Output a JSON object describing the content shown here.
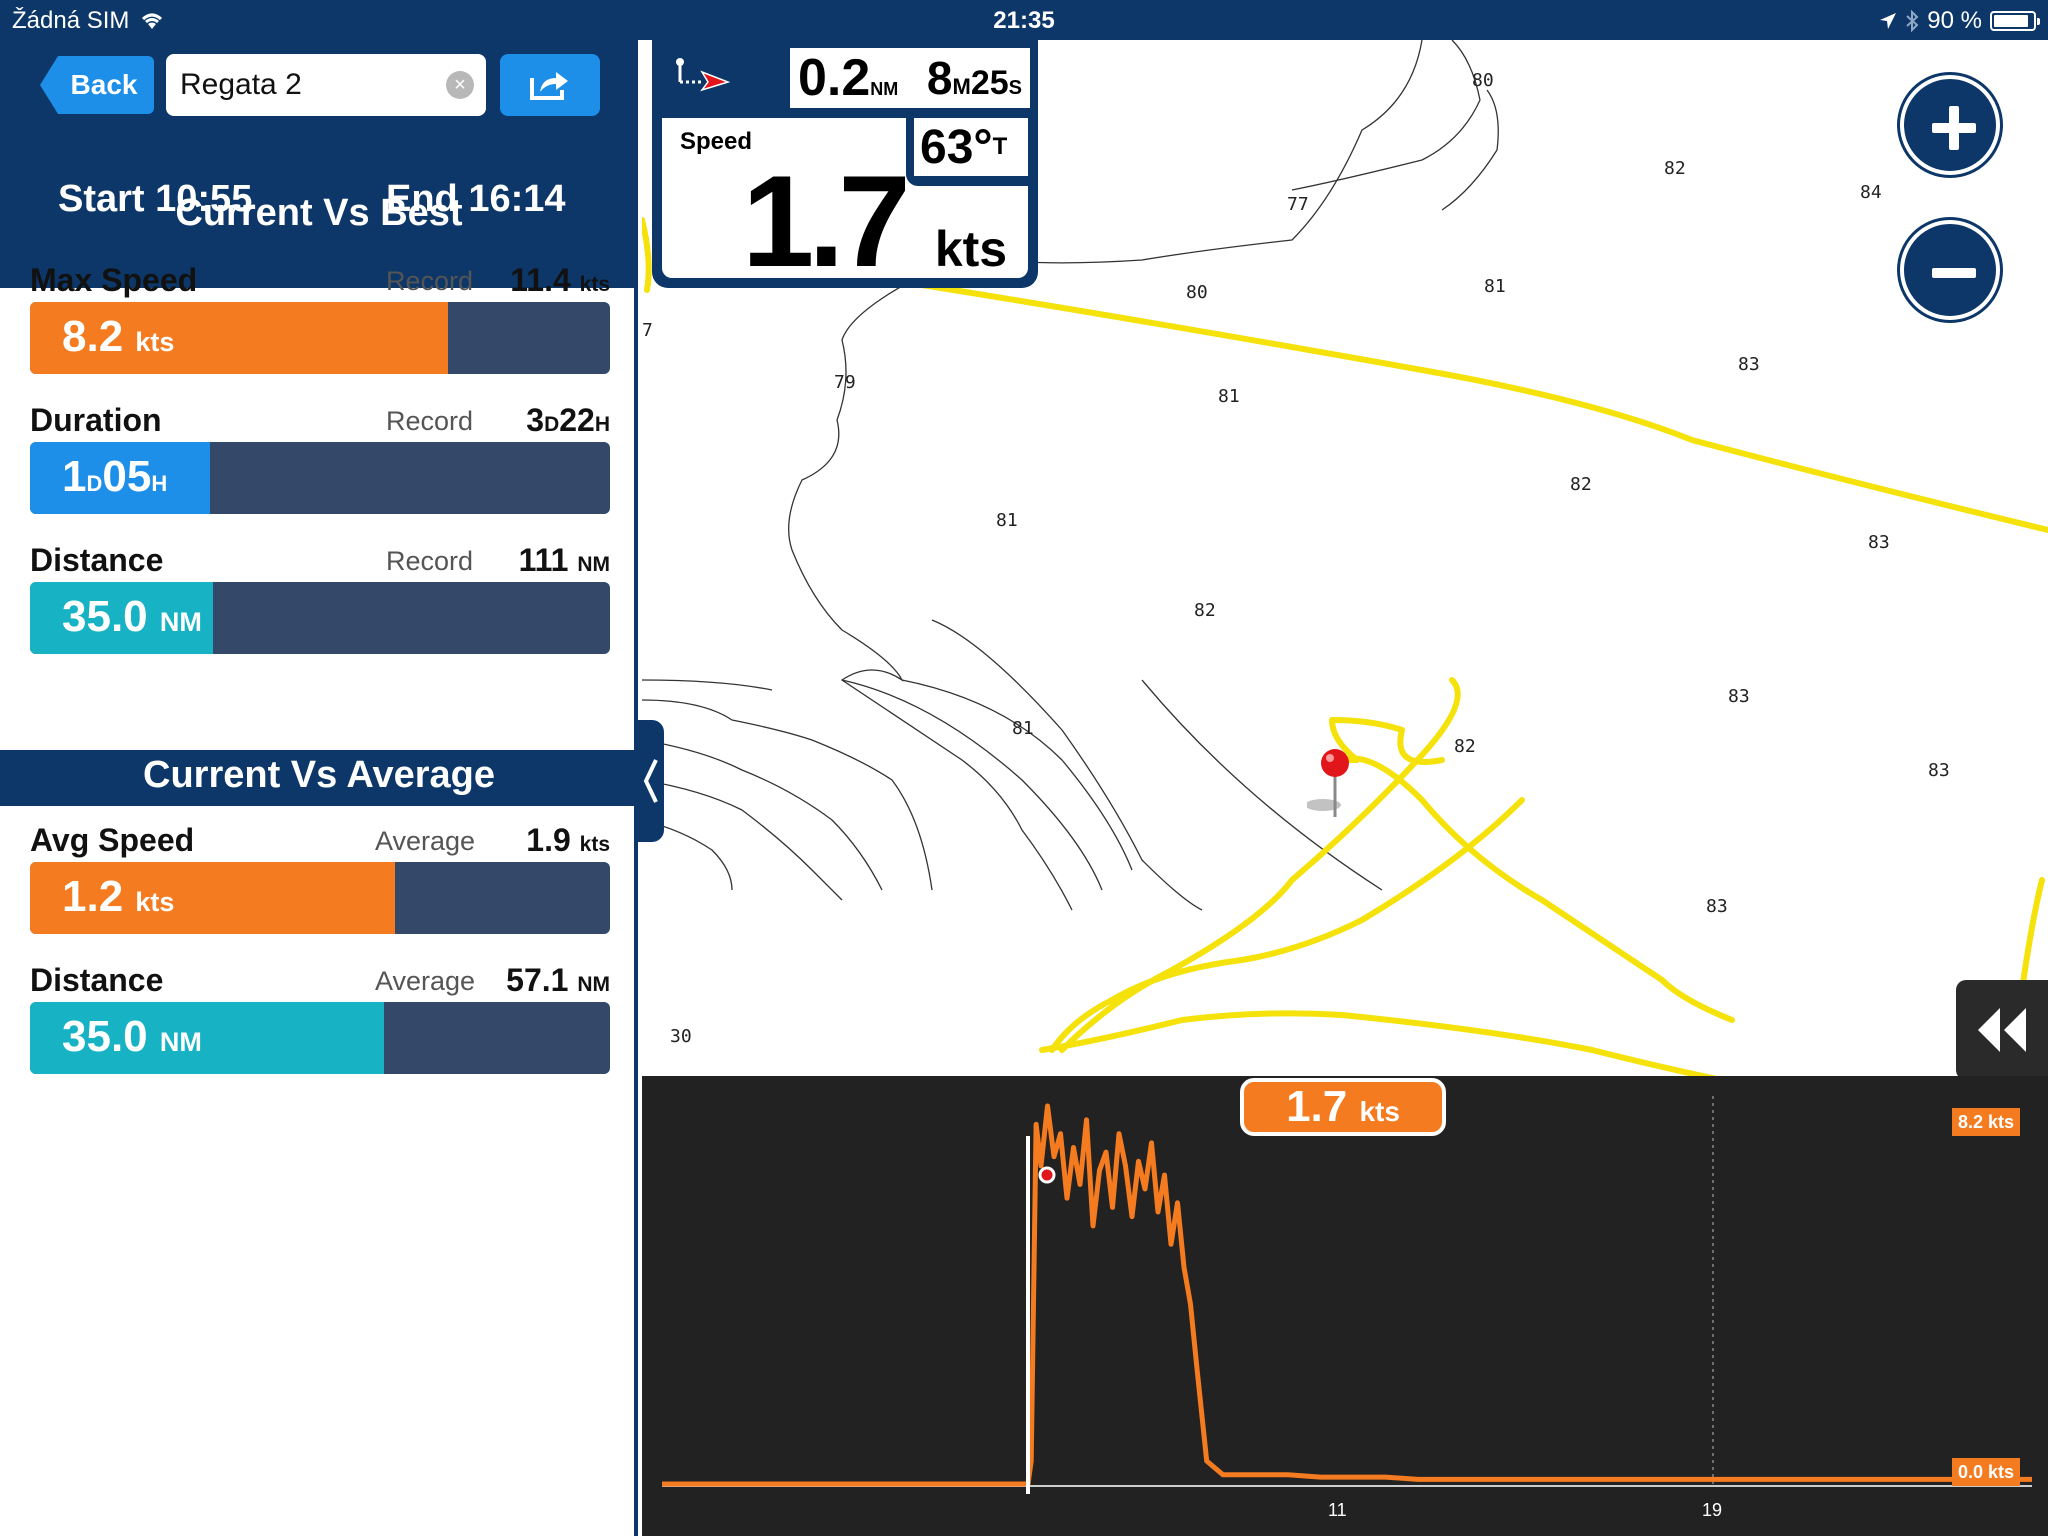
{
  "status_bar": {
    "carrier": "Žádná SIM",
    "time": "21:35",
    "battery_text": "90 %",
    "battery_level": 0.9
  },
  "toolbar": {
    "back_label": "Back",
    "track_name": "Regata 2"
  },
  "times": {
    "start": "Start 10:55",
    "end": "End 16:14"
  },
  "best_section": {
    "title": "Current Vs Best",
    "metrics": [
      {
        "label": "Max Speed",
        "caption": "Record",
        "record_value": "11.4",
        "record_unit": "kts",
        "value": "8.2",
        "unit": "kts",
        "fraction": 0.72,
        "color": "#f47b20"
      },
      {
        "label": "Duration",
        "caption": "Record",
        "record_d": "3",
        "record_h": "22",
        "value_d": "1",
        "value_h": "05",
        "fraction": 0.31,
        "color": "#1d8fe8"
      },
      {
        "label": "Distance",
        "caption": "Record",
        "record_value": "111",
        "record_unit": "NM",
        "value": "35.0",
        "unit": "NM",
        "fraction": 0.315,
        "color": "#17b3c4"
      }
    ]
  },
  "average_section": {
    "title": "Current Vs Average",
    "metrics": [
      {
        "label": "Avg Speed",
        "caption": "Average",
        "record_value": "1.9",
        "record_unit": "kts",
        "value": "1.2",
        "unit": "kts",
        "fraction": 0.63,
        "color": "#f47b20"
      },
      {
        "label": "Distance",
        "caption": "Average",
        "record_value": "57.1",
        "record_unit": "NM",
        "value": "35.0",
        "unit": "NM",
        "fraction": 0.61,
        "color": "#17b3c4"
      }
    ]
  },
  "instrument": {
    "distance_value": "0.2",
    "distance_unit": "NM",
    "eta_min": "8",
    "eta_min_unit": "M",
    "eta_sec": "25",
    "eta_sec_unit": "S",
    "speed_label": "Speed",
    "speed_value": "1.7",
    "speed_unit": "kts",
    "heading_value": "63°",
    "heading_unit": "T"
  },
  "map": {
    "depths": [
      "80",
      "82",
      "84",
      "77",
      "80",
      "81",
      "83",
      "79",
      "81",
      "82",
      "81",
      "83",
      "82",
      "83",
      "81",
      "82",
      "83",
      "83",
      "7",
      "30"
    ]
  },
  "chart_data": {
    "type": "line",
    "cursor_value": "1.7",
    "cursor_unit": "kts",
    "max_label": "8.2 kts",
    "min_label": "0.0 kts",
    "x_ticks": [
      "11",
      "19"
    ],
    "ylim": [
      0,
      8.2
    ],
    "series": [
      {
        "color": "#f47b20",
        "x": [
          0.0,
          0.8,
          1.0,
          1.2,
          1.5,
          1.8,
          2.0,
          2.2,
          2.5,
          2.8,
          3.0,
          3.3,
          3.6,
          3.9,
          4.2,
          4.5,
          4.8,
          5.1,
          5.4,
          5.7,
          6.0,
          6.3,
          6.6,
          7.0,
          7.5,
          8.0,
          9.0,
          10.0,
          11.0,
          11.1,
          11.25,
          11.4,
          11.6,
          11.8,
          12.0,
          12.2,
          12.4,
          12.6,
          12.8,
          13.0,
          13.2,
          13.4,
          13.6,
          13.8,
          14.0,
          14.2,
          14.4,
          14.6,
          14.8,
          15.0,
          15.2,
          15.4,
          15.6,
          15.8,
          16.0,
          16.2,
          16.5,
          17.0,
          18.0,
          19.0,
          20.0,
          21.0,
          22.0,
          23.0,
          24.0,
          25.0,
          26.0,
          27.0,
          28.0,
          29.0,
          30.0,
          31.0,
          32.0,
          33.0,
          34.0,
          35.0,
          36.0,
          37.0,
          38.0,
          39.0,
          40.0,
          41.0,
          41.9
        ],
        "values": [
          0,
          0,
          0,
          0,
          0,
          0,
          0,
          0,
          0,
          0,
          0,
          0,
          0,
          0,
          0,
          0,
          0,
          0,
          0,
          0,
          0,
          0,
          0,
          0,
          0,
          0,
          0,
          0,
          0,
          0.5,
          7.8,
          6.9,
          8.2,
          7.1,
          7.6,
          6.2,
          7.3,
          6.5,
          7.9,
          5.6,
          6.8,
          7.2,
          6.0,
          7.6,
          6.9,
          5.8,
          7.0,
          6.4,
          7.4,
          5.9,
          6.7,
          5.2,
          6.1,
          4.7,
          3.9,
          2.5,
          0.5,
          0.2,
          0.2,
          0.2,
          0.15,
          0.15,
          0.15,
          0.1,
          0.1,
          0.1,
          0.1,
          0.1,
          0.1,
          0.1,
          0.1,
          0.1,
          0.1,
          0.1,
          0.1,
          0.1,
          0.1,
          0.1,
          0.1,
          0.1,
          0.1,
          0.1,
          0.1
        ]
      }
    ]
  }
}
